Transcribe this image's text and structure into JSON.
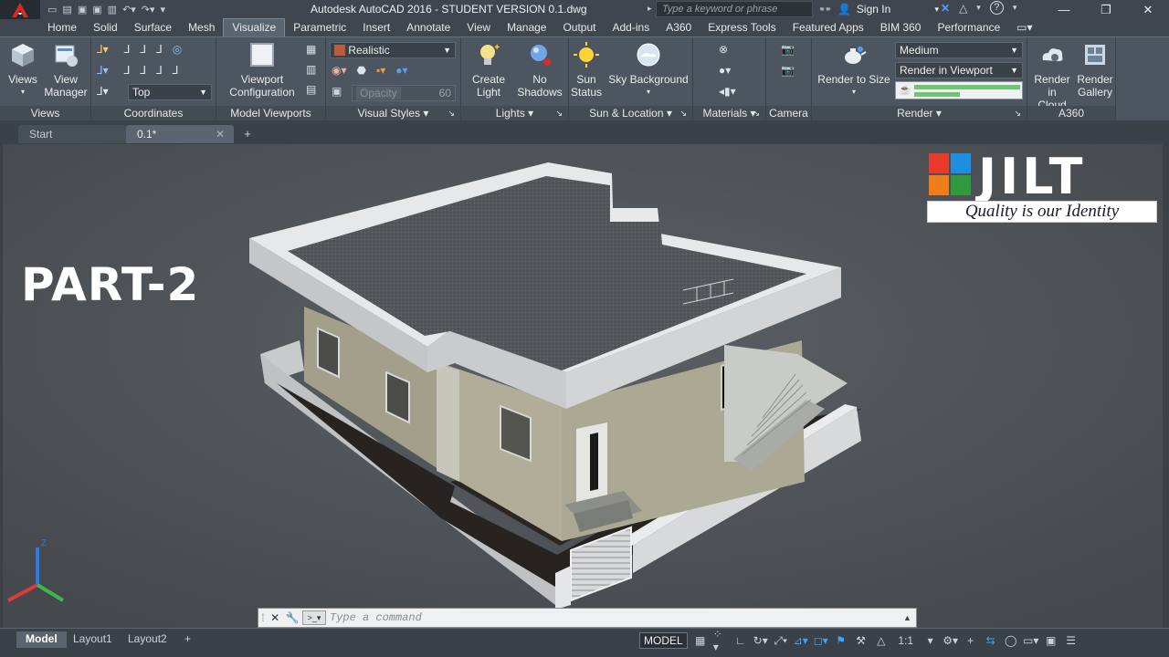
{
  "title_bar": {
    "window_title": "Autodesk AutoCAD 2016 - STUDENT VERSION    0.1.dwg",
    "search_placeholder": "Type a keyword or phrase",
    "sign_in_label": "Sign In"
  },
  "ribbon_tabs": [
    "Home",
    "Solid",
    "Surface",
    "Mesh",
    "Visualize",
    "Parametric",
    "Insert",
    "Annotate",
    "View",
    "Manage",
    "Output",
    "Add-ins",
    "A360",
    "Express Tools",
    "Featured Apps",
    "BIM 360",
    "Performance"
  ],
  "active_tab": "Visualize",
  "panels": {
    "views": {
      "title": "Views",
      "btn_views": "Views",
      "btn_view_manager_1": "View",
      "btn_view_manager_2": "Manager"
    },
    "coordinates": {
      "title": "Coordinates",
      "ucs_value": "Top"
    },
    "model_viewports": {
      "title": "Model Viewports",
      "btn_1": "Viewport",
      "btn_2": "Configuration"
    },
    "visual_styles": {
      "title": "Visual Styles",
      "style_value": "Realistic",
      "opacity_label": "Opacity",
      "opacity_value": "60"
    },
    "lights": {
      "title": "Lights",
      "create_1": "Create",
      "create_2": "Light",
      "shadows_1": "No",
      "shadows_2": "Shadows"
    },
    "sun_location": {
      "title": "Sun & Location",
      "sun_1": "Sun",
      "sun_2": "Status",
      "sky": "Sky Background"
    },
    "materials": {
      "title": "Materials"
    },
    "camera": {
      "title": "Camera"
    },
    "render": {
      "title": "Render",
      "render_size": "Render to Size",
      "quality_value": "Medium",
      "render_mode_value": "Render in Viewport"
    },
    "a360": {
      "title": "A360",
      "cloud_1": "Render in",
      "cloud_2": "Cloud",
      "gallery_1": "Render",
      "gallery_2": "Gallery"
    }
  },
  "file_tabs": {
    "start": "Start",
    "current": "0.1*"
  },
  "viewport": {
    "overlay_text": "PART-2",
    "logo_text": "JILT",
    "logo_tagline": "Quality is our Identity",
    "logo_colors": [
      "#e8392b",
      "#1d8fe0",
      "#f07d1a",
      "#2e9b3e"
    ]
  },
  "command_line": {
    "placeholder": "Type  a  command"
  },
  "layout_tabs": [
    "Model",
    "Layout1",
    "Layout2"
  ],
  "status_bar": {
    "model_label": "MODEL",
    "scale_label": "1:1"
  }
}
